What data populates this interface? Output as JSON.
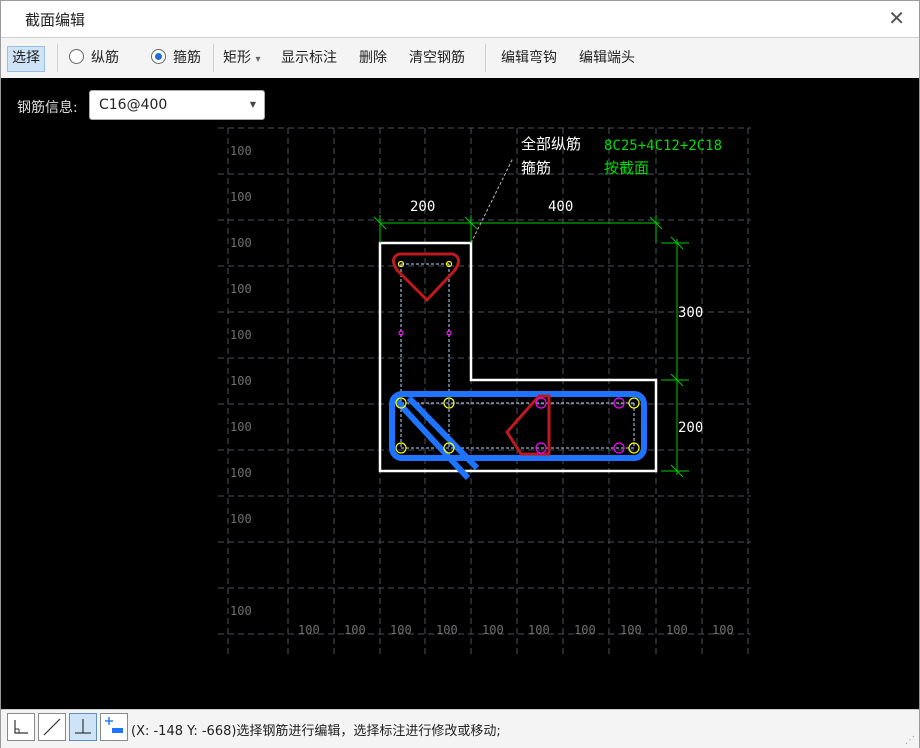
{
  "window": {
    "title": "截面编辑",
    "close_glyph": "✕"
  },
  "toolbar": {
    "select": "选择",
    "longitudinal": "纵筋",
    "stirrup": "箍筋",
    "shape": "矩形",
    "shape_arrow": "▾",
    "show_dims": "显示标注",
    "delete": "删除",
    "clear": "清空钢筋",
    "edit_hook": "编辑弯钩",
    "edit_end": "编辑端头"
  },
  "rebar_info": {
    "label": "钢筋信息:",
    "value": "C16@400",
    "arrow": "▼"
  },
  "drawing": {
    "grid_label": "100",
    "dims": {
      "top_left": "200",
      "top_right": "400",
      "right_top": "300",
      "right_bottom": "200"
    },
    "annotation": {
      "all_long": "全部纵筋",
      "long_value": "8C25+4C12+2C18",
      "stirrup": "箍筋",
      "stirrup_value": "按截面"
    },
    "colors": {
      "background": "#000000",
      "outline": "#ffffff",
      "dimension": "#00cc00",
      "stirrup_selected": "#1e73ff",
      "stirrup": "#c0191d",
      "bar": "#ffff00",
      "bar_alt": "#ff00ff"
    }
  },
  "statusbar": {
    "text": "(X: -148 Y: -668)选择钢筋进行编辑，选择标注进行修改或移动;",
    "icons": [
      "ortho-corner-icon",
      "angle-line-icon",
      "perpendicular-icon",
      "add-point-icon"
    ]
  }
}
